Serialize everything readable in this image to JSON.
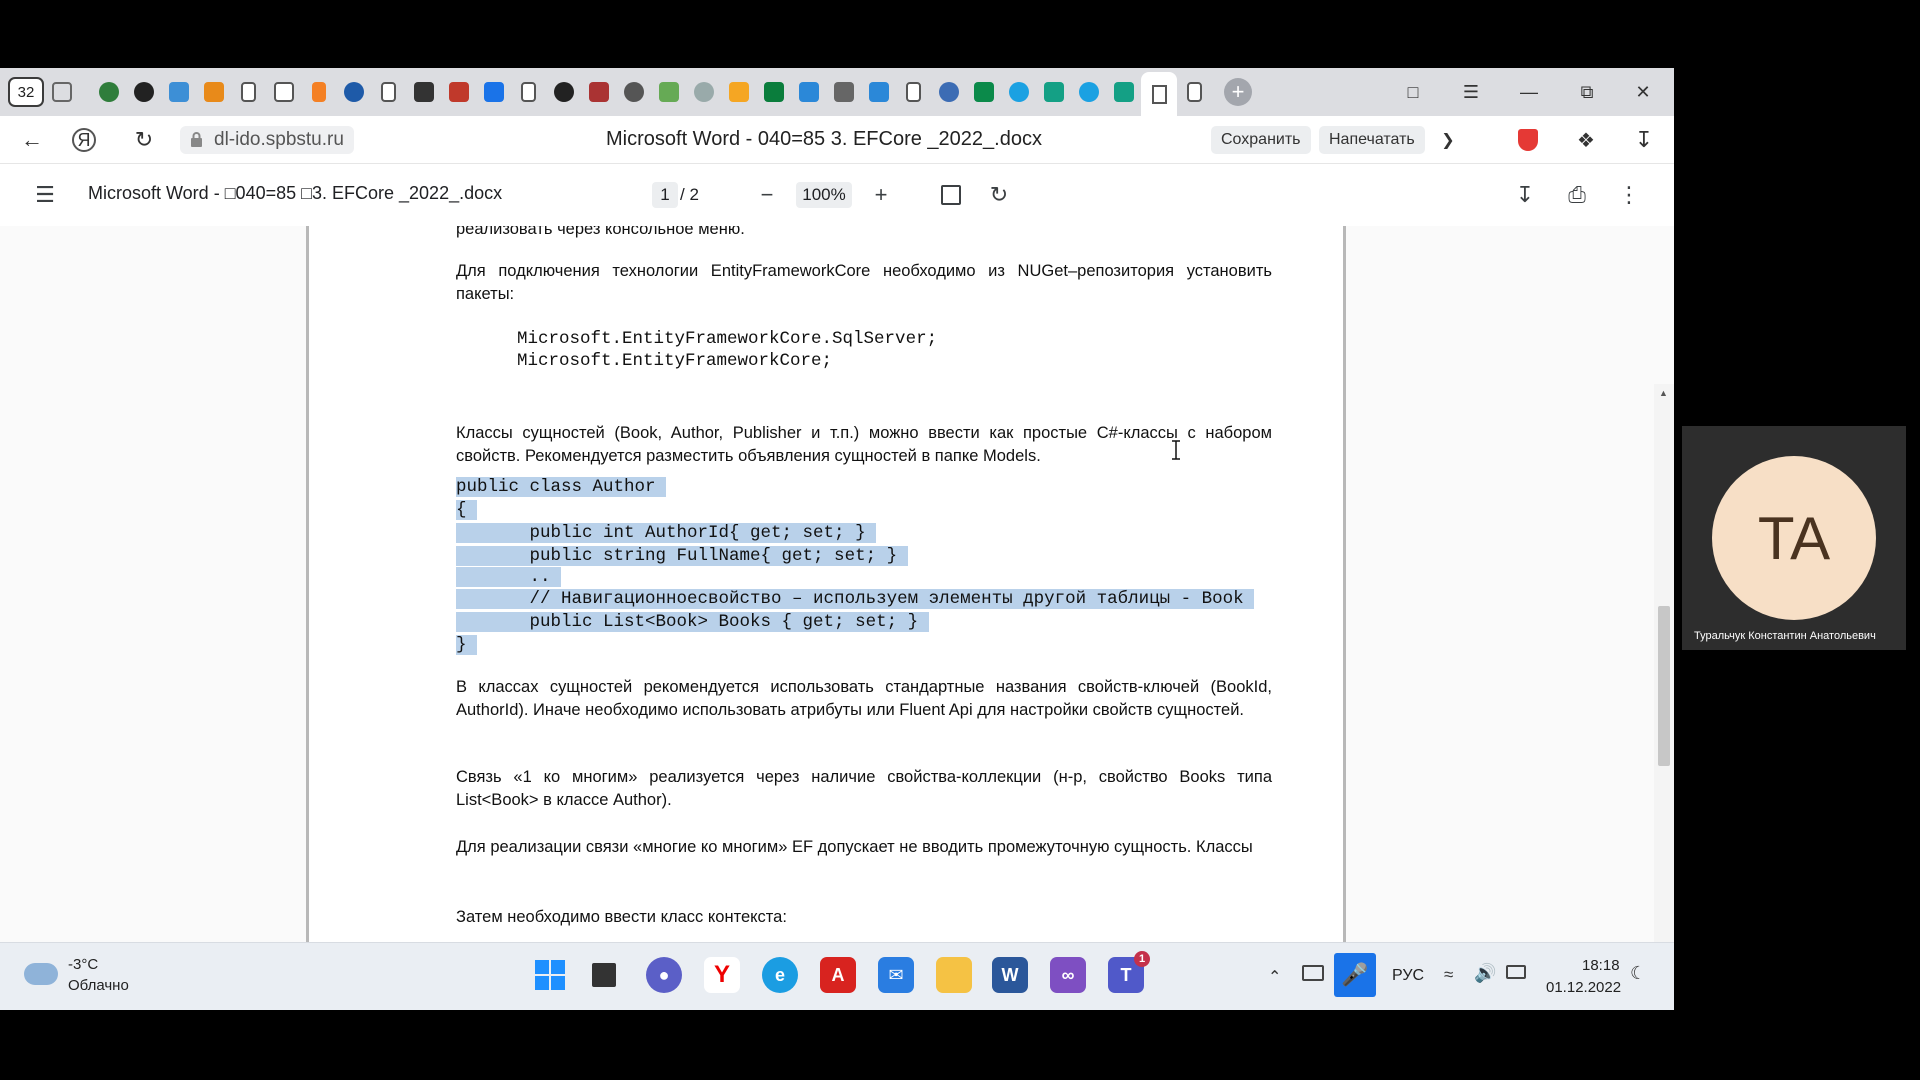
{
  "browser": {
    "tab_count": "32",
    "url": "dl-ido.spbstu.ru",
    "title": "Microsoft Word - 040=85 3. EFCore _2022_.docx",
    "save_label": "Сохранить",
    "print_label": "Напечатать"
  },
  "pdf_toolbar": {
    "doc_title": "Microsoft Word - □040=85 □3. EFCore _2022_.docx",
    "current_page": "1",
    "total_pages": "/  2",
    "zoom": "100%"
  },
  "document": {
    "p0": "реализовать через консольное меню.",
    "p1": "Для подключения технологии EntityFrameworkCore необходимо из NUGet–репозитория установить пакеты:",
    "pkg1": "Microsoft.EntityFrameworkCore.SqlServer;",
    "pkg2": "Microsoft.EntityFrameworkCore;",
    "p2": "Классы сущностей (Book, Author, Publisher и т.п.) можно ввести как простые C#-классы с набором свойств. Рекомендуется разместить объявления сущностей в папке Models.",
    "code": [
      "public class Author ",
      "{ ",
      "       public int AuthorId{ get; set; } ",
      "       public string FullName{ get; set; } ",
      "       .. ",
      "       // Навигационноесвойство – используем элементы другой таблицы - Book ",
      "       public List<Book> Books { get; set; } ",
      "} "
    ],
    "p3": "В классах сущностей рекомендуется использовать стандартные названия свойств-ключей (BookId, AuthorId). Иначе необходимо использовать атрибуты или Fluent Api для настройки свойств сущностей.",
    "p4": "Связь «1 ко многим» реализуется через наличие свойства-коллекции (н-р,  свойство Books типа List<Book> в классе Author).",
    "p5": "Для реализации связи «многие ко многим» EF допускает не вводить промежуточную сущность. Классы",
    "p6": "Затем необходимо ввести класс контекста:"
  },
  "taskbar": {
    "weather_temp": "-3°C",
    "weather_desc": "Облачно",
    "teams_badge": "1",
    "language": "РУС",
    "time": "18:18",
    "date": "01.12.2022"
  },
  "participant": {
    "initials": "TA",
    "name": "Туральчук Константин Анатольевич"
  },
  "colors": {
    "selection": "#b9d1ea",
    "avatar_bg": "#f7dfc6",
    "mic_active": "#1a73e8"
  }
}
